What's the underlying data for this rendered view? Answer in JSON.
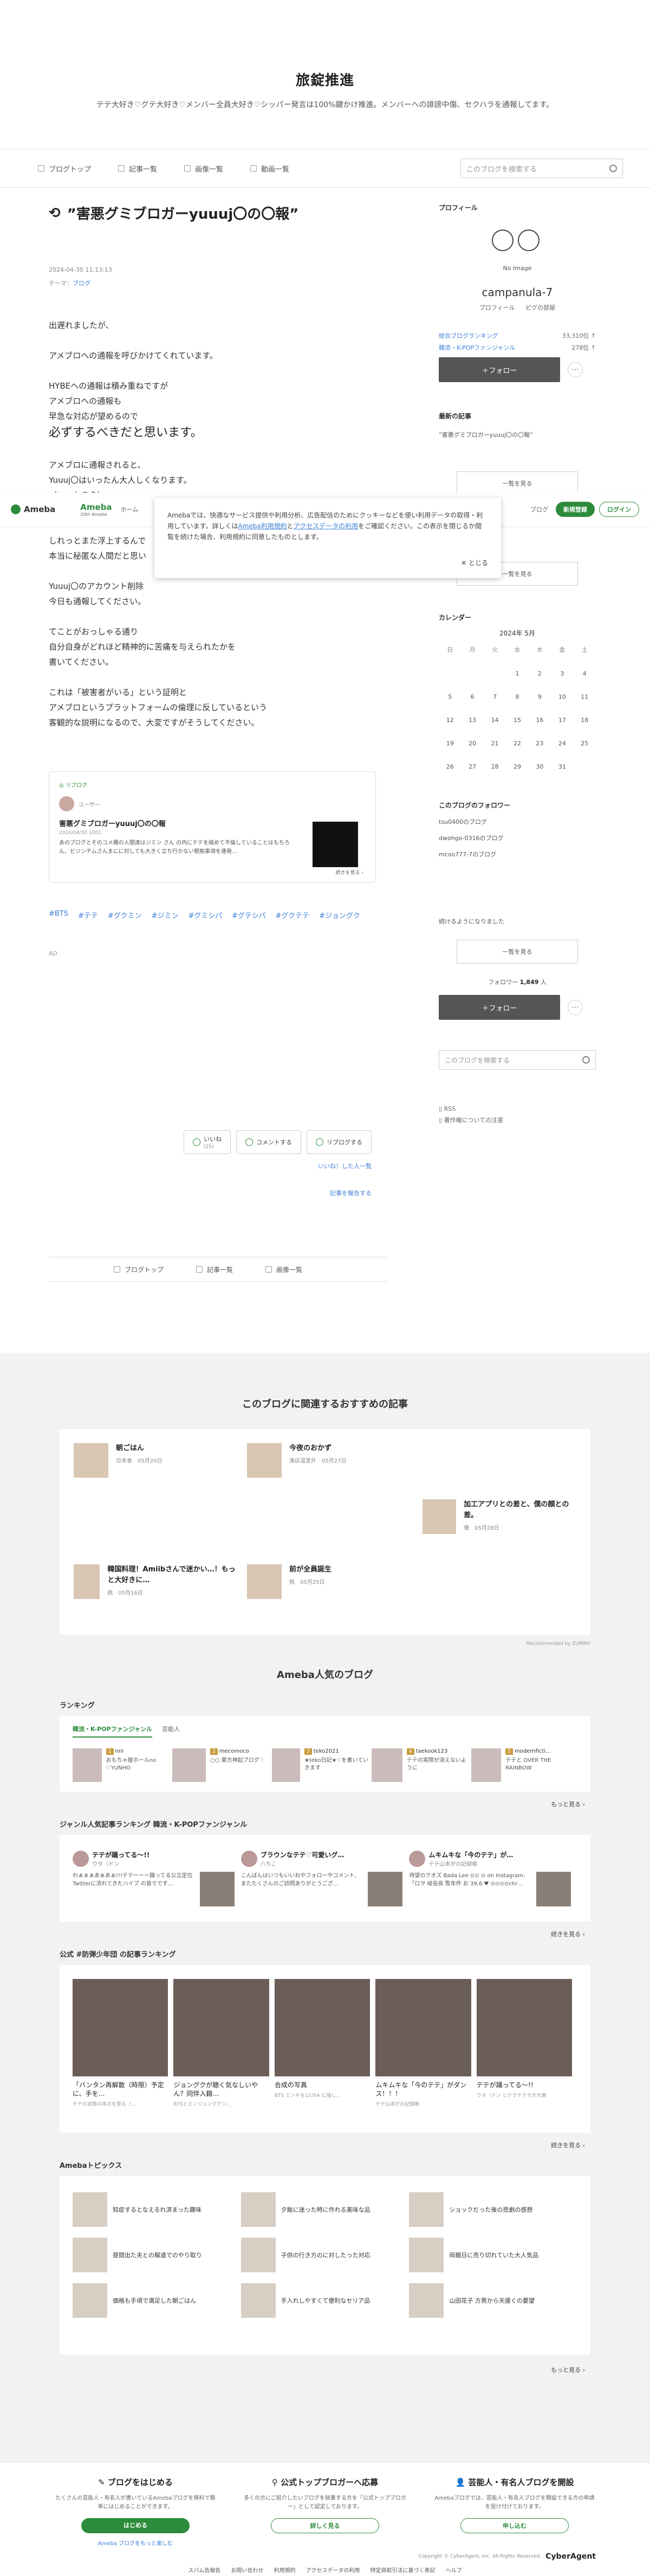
{
  "header": {
    "title": "旅錠推進",
    "description": "テテ大好き♡グテ大好き♡メンバー全員大好き♡シッパー発言は100%鍵かけ推進。メンバーへの誹謗中傷、セクハラを通報してます。"
  },
  "nav": {
    "items": [
      "ブログトップ",
      "記事一覧",
      "画像一覧",
      "動画一覧"
    ],
    "search_placeholder": "このブログを検索する"
  },
  "article": {
    "title": "”害悪グミブロガーyuuuj〇の〇報”",
    "date": "2024-04-30 11:13:13",
    "theme_label": "テーマ：",
    "theme": "ブログ",
    "paragraphs": [
      "出遅れましたが、",
      "",
      "アメブロへの通報を呼びかけてくれています。",
      "",
      "HYBEへの通報は積み重ねですが",
      "アメブロへの通報も",
      "早急な対応が望めるので"
    ],
    "big_line": "必ずするべきだと思います。",
    "paragraphs2": [
      "",
      "アメブロに通報されると、",
      "Yuuuj〇はいったん大人しくなります。",
      "（いつもそう）",
      "",
      "",
      "しれっとまた浮上するんで",
      "本当に秘匿な人間だと思い",
      "",
      "Yuuuj〇のアカウント削除",
      "今日も通報してください。",
      "",
      "てことがおっしゃる通り",
      "自分自身がどれほど精神的に苦痛を与えられたかを",
      "書いてください。",
      "",
      "これは「被害者がいる」という証明と",
      "アメブロというプラットフォームの倫理に反しているという",
      "客観的な説明になるので、大変ですがそうしてください。"
    ]
  },
  "consent": {
    "text1": "Amebaでは、快適なサービス提供や利用分析、広告配信のためにクッキーなどを使い利用データの取得・利用しています。詳しくは",
    "link1": "Ameba利用規約",
    "and": "と",
    "link2": "アクセスデータの利用",
    "text2": "をご確認ください。この表示を閉じるか閲覧を続けた場合、利用規約に同意したものとします。",
    "close": "✕ とじる"
  },
  "ameba_bar": {
    "logo": "Ameba",
    "logo2": "Ameba",
    "logo2_sub": "20th Ameba",
    "home": "ホーム",
    "blog": "ブログ",
    "register": "新規登録",
    "login": "ログイン"
  },
  "embed": {
    "tag": "◎ リブログ",
    "user": "ユーザー",
    "title": "害悪グミブロガーyuuuj〇の〇報",
    "date": "2024/04/30 1002",
    "text": "あのブログとそのコメ欄の人間達はジミン さん の内にテテを絡めて不倫していることはもちろん、ビジンチムさんまにに対しても大きく立ち行かない根拠事項を連発…",
    "more": "続きを見る ›"
  },
  "hashtags": [
    "#BTS",
    "#テテ",
    "#グクミン",
    "#ジミン",
    "#グミシパ",
    "#グテシパ",
    "#グクテテ",
    "#ジョングク"
  ],
  "ad_label": "AD",
  "reactions": {
    "like": "いいね",
    "like_count": "(25)",
    "comment": "コメントする",
    "reblog": "リブログする",
    "liked_users": "いいね！した人一覧",
    "report": "記事を報告する"
  },
  "bottom_nav": [
    "ブログトップ",
    "記事一覧",
    "画像一覧"
  ],
  "sidebar": {
    "profile_title": "プロフィール",
    "no_image": "No Image",
    "name": "campanula-7",
    "profile_links": [
      "プロフィール",
      "ピグの部屋"
    ],
    "ranks": [
      {
        "label": "総合ブログランキング",
        "value": "33,310位 ↑"
      },
      {
        "label": "韓流・K-POPファンジャンル",
        "value": "278位 ↑"
      }
    ],
    "follow": "＋フォロー",
    "latest_title": "最新の記事",
    "latest_item": "”害悪グミブロガーyuuuj〇の〇報”",
    "list_button": "一覧を見る",
    "monthly_title": "月別",
    "monthly_item": "2024年4月",
    "calendar_title": "カレンダー",
    "calendar_month": "2024年 5月",
    "weekdays": [
      "日",
      "月",
      "火",
      "水",
      "木",
      "金",
      "土"
    ],
    "days": [
      "",
      "",
      "",
      "1",
      "2",
      "3",
      "4",
      "5",
      "6",
      "7",
      "8",
      "9",
      "10",
      "11",
      "12",
      "13",
      "14",
      "15",
      "16",
      "17",
      "18",
      "19",
      "20",
      "21",
      "22",
      "23",
      "24",
      "25",
      "26",
      "27",
      "28",
      "29",
      "30",
      "31",
      ""
    ],
    "followers_title": "このブログのフォロワー",
    "followers": [
      "tsu0400のブログ",
      "dwohgo-0316のブログ",
      "mcoo777-7のブログ"
    ],
    "note": "続けるようになりました",
    "follower_count_label": "フォロワー",
    "follower_count": "1,849",
    "follower_count_suffix": "人",
    "search_placeholder": "このブログを検索する",
    "rss": "RSS",
    "rss_note": "著作権についての注意"
  },
  "recommend": {
    "title": "このブログに関連するおすすめの記事",
    "items": [
      {
        "title": "朝ごはん",
        "sub": "日本食　05月20日"
      },
      {
        "title": "今夜のおかず",
        "sub": "漁店温室外　05月27日"
      },
      {
        "title": "加工アプリとの差と、僕の顔との差。",
        "sub": "僕　05月28日"
      },
      {
        "title": "韓国料理！Amiibさんで迷かい…！もっと大好きに…",
        "sub": "桃　05月16日"
      },
      {
        "title": "前が全員誕生",
        "sub": "桃　05月25日"
      }
    ],
    "credit": "Recommended by ZUMMY"
  },
  "popular": {
    "title": "Ameba人気のブログ",
    "ranking_title": "ランキング",
    "tabs": [
      "韓流・K-POPファンジャンル",
      "芸能人"
    ],
    "rank_cards": [
      {
        "name": "nni",
        "text": "おもちゃ屋ホールno ♡YUNHO"
      },
      {
        "name": "mecomoco",
        "text": "○○ 東方神起ブログ♡"
      },
      {
        "name": "teko2021",
        "text": "★teko日記★♡を書いていきます"
      },
      {
        "name": "taekook123",
        "text": "テテの実際が消えないように"
      },
      {
        "name": "modernficti...",
        "text": "テテと OVER THE RAINBOW"
      }
    ],
    "more": "もっと見る ›",
    "genre_title": "ジャンル人気記事ランキング 韓流・K-POPファンジャンル",
    "genre_cards": [
      {
        "title": "テテが踊ってる〜!!",
        "sub": "ウタ（ドン",
        "text": "わぁぁぁあぁあぁ!!!テテーーー踊ってる公立定位Twitterに流れてきたハイブ の皆でです…"
      },
      {
        "title": "ブラウンなテテ♡可愛いグ…",
        "sub": "八ちこ",
        "text": "こんばんはいつもいいねやフォローやコメント、またたくさんのご訪問ありがとうござ…"
      },
      {
        "title": "ムキムキな「今のテテ」が…",
        "sub": "テテ山本がの記録帳",
        "text": "待望のクオズ Bada Lee ⊙⊙ ⊙ on Instagram:「ロヲ 岐岳良 覧年件 お 39,6 ♥ ⊙⊙⊙⊙chr…"
      }
    ],
    "genre_more": "続きを見る ›",
    "tag_title": "公式 #防弾少年団 の記事ランキング",
    "tag_cards": [
      {
        "title": "「バンタン再解散（時限）予定に、手を…",
        "sub": "テテの実態の本のを見る（…"
      },
      {
        "title": "ジョングクが聴く気なしいやん？同伴入籍…",
        "sub": "BTSとミンジュングクン…"
      },
      {
        "title": "合成の写真",
        "sub": "BTS ミンキを公USA に強し…"
      },
      {
        "title": "ムキムキな「今のテテ」がダンス！！！",
        "sub": "テテ山本がの記録帳"
      },
      {
        "title": "テテが踊ってる〜!!",
        "sub": "ウタ（ドン ヒテクナテサ大大衆"
      }
    ],
    "tag_more": "続きを見る ›",
    "topics_title": "Amebaトピックス",
    "topics": [
      "知症するとなえるれ済まった趣味",
      "夕飯に迷った時に作れる美味な品",
      "ショックだった後の悲劇の感想",
      "昼間出た夫との報道でのやり取り",
      "子供の行き方のに対したった対応",
      "両親日に売り切れていた大人気品",
      "価格も手頃で満足した朝ごはん",
      "手入れしやすくて便利なセリア品",
      "山田花子 方男から天援くの要望"
    ],
    "topics_more": "もっと見る ›"
  },
  "cta": [
    {
      "title": "ブログをはじめる",
      "desc": "たくさんの芸能人・有名人が書いているAmebaブログを無料で簡単にはじめることができます。",
      "button": "はじめる",
      "foot": "Ameba ブログをもっと楽しむ"
    },
    {
      "title": "公式トップブロガーへ応募",
      "desc": "多くの方にご紹介したいブログを執筆する方を「公式トップブロガー」として認定しております。",
      "button": "詳しく見る",
      "foot": ""
    },
    {
      "title": "芸能人・有名人ブログを開設",
      "desc": "Amebaブログでは、芸能人・有名人ブログを開設できる方の申請を受け付けております。",
      "button": "申し込む",
      "foot": ""
    }
  ],
  "footer": {
    "copyright": "Copyright © CyberAgent, Inc. All Rights Reserved.",
    "brand": "CyberAgent",
    "links": [
      "スパム告報告",
      "お問い合わせ",
      "利用規約",
      "アクセスデータの利用",
      "特定商取引法に基づく表記",
      "ヘルプ"
    ]
  }
}
